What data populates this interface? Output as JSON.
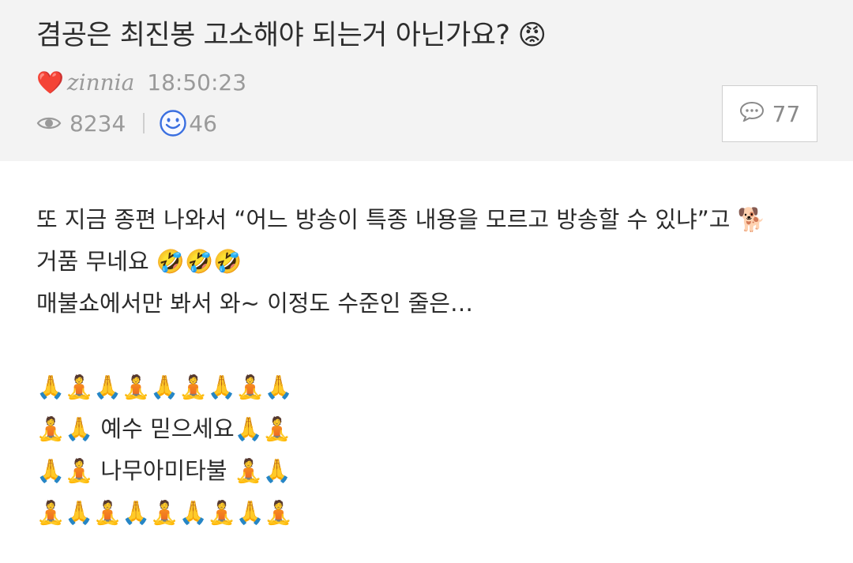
{
  "post": {
    "title": "겸공은 최진봉 고소해야 되는거 아닌가요?",
    "title_emoji": "😡",
    "author_badge": "❤️",
    "author": "zinnia",
    "time": "18:50:23",
    "views": "8234",
    "likes": "46",
    "comments": "77"
  },
  "icons": {
    "views": "eye-icon",
    "likes": "smiley-icon",
    "comments": "speech-bubble-icon"
  },
  "body": {
    "lines": [
      "또 지금 종편 나와서 “어느 방송이 특종 내용을 모르고 방송할 수 있냐”고 🐕",
      "거품 무네요 🤣🤣🤣",
      "매불쇼에서만 봐서 와~ 이정도 수준인 줄은…",
      "",
      "🙏🧘🙏🧘🙏🧘🙏🧘🙏",
      "🧘🙏 예수 믿으세요🙏🧘",
      "🙏🧘 나무아미타불 🧘🙏",
      "🧘🙏🧘🙏🧘🙏🧘🙏🧘"
    ]
  },
  "colors": {
    "header_bg": "#f3f3f3",
    "meta_text": "#9a9a9a",
    "heart": "#e23340",
    "smiley": "#3a6fe0"
  }
}
